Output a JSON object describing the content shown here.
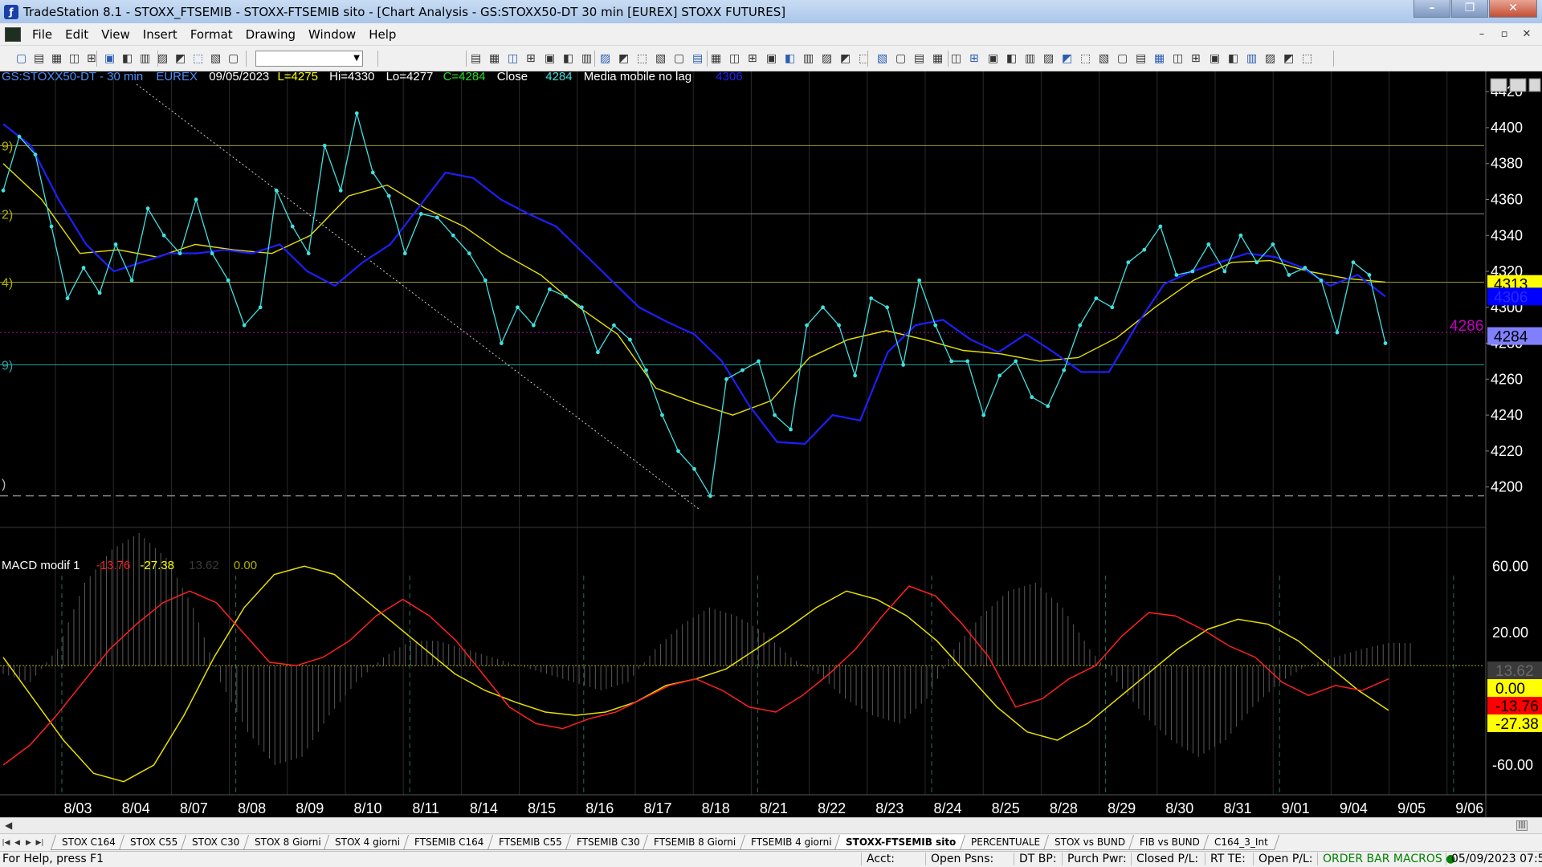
{
  "window": {
    "title": "TradeStation 8.1 - STOXX_FTSEMIB - STOXX-FTSEMIB sito - [Chart Analysis - GS:STOXX50-DT  30 min  [EUREX] STOXX FUTURES]"
  },
  "menu": [
    "File",
    "Edit",
    "View",
    "Insert",
    "Format",
    "Drawing",
    "Window",
    "Help"
  ],
  "price_header": {
    "symbol": "GS:STOXX50-DT - 30 min",
    "exchange": "EUREX",
    "date": "09/05/2023",
    "l": "L=4275",
    "hi": "Hi=4330",
    "lo": "Lo=4277",
    "c": "C=4284",
    "close_label": "Close",
    "close_value": "4284",
    "ma_label": "Media mobile no lag",
    "ma_value": "4306"
  },
  "macd_header": {
    "name": "MACD modif 1",
    "v1": "-13.76",
    "v2": "-27.38",
    "v3": "13.62",
    "v4": "0.00"
  },
  "left_labels": [
    "9)",
    "2)",
    "4)",
    "9)",
    ")"
  ],
  "price_axis": [
    "4420",
    "4400",
    "4380",
    "4360",
    "4340",
    "4320",
    "4300",
    "4280",
    "4260",
    "4240",
    "4220",
    "4200"
  ],
  "price_badges": [
    {
      "text": "4313",
      "price": 4313,
      "bg": "#ffff00",
      "fg": "#000000"
    },
    {
      "text": "4306",
      "price": 4306,
      "bg": "#0000ff",
      "fg": "#2a2aff"
    },
    {
      "text": "4284",
      "price": 4284,
      "bg": "#8080ff",
      "fg": "#000000"
    }
  ],
  "price_side_label": {
    "text": "4286",
    "price": 4286,
    "color": "#c000c0"
  },
  "macd_axis": [
    "60.00",
    "20.00",
    "-60.00"
  ],
  "macd_badges": [
    {
      "text": "13.62",
      "bg": "#3a3a3a",
      "fg": "#6a6a6a"
    },
    {
      "text": "0.00",
      "bg": "#ffff00",
      "fg": "#000000"
    },
    {
      "text": "-13.76",
      "bg": "#ff0000",
      "fg": "#000000"
    },
    {
      "text": "-27.38",
      "bg": "#ffff00",
      "fg": "#000000"
    }
  ],
  "time_axis": [
    "8/03",
    "8/04",
    "8/07",
    "8/08",
    "8/09",
    "8/10",
    "8/11",
    "8/14",
    "8/15",
    "8/16",
    "8/17",
    "8/18",
    "8/21",
    "8/22",
    "8/23",
    "8/24",
    "8/25",
    "8/28",
    "8/29",
    "8/30",
    "8/31",
    "9/01",
    "9/04",
    "9/05",
    "9/06"
  ],
  "hlines": [
    {
      "price": 4390,
      "color": "#9a9a2a",
      "style": "solid"
    },
    {
      "price": 4352,
      "color": "#8a8a8a",
      "style": "solid"
    },
    {
      "price": 4314,
      "color": "#9a9a2a",
      "style": "solid"
    },
    {
      "price": 4286,
      "color": "#c000c0",
      "style": "dotted"
    },
    {
      "price": 4268,
      "color": "#2aa0a0",
      "style": "solid"
    },
    {
      "price": 4195,
      "color": "#bbbbbb",
      "style": "dashed"
    }
  ],
  "colors": {
    "background": "#000000",
    "price": "#40e0e0",
    "ma_blue": "#1e1eff",
    "ma_yellow": "#e8e000",
    "macd_red": "#ff2020",
    "macd_yellow": "#e8e000",
    "histogram": "#5a5a5a",
    "grid": "#2a2a2a",
    "session": "#1f6f5f",
    "trendline": "#cccccc"
  },
  "chart_data": {
    "type": "line",
    "title": "GS:STOXX50-DT - 30 min",
    "xlabel": "",
    "ylabel": "",
    "ylim": [
      4190,
      4425
    ],
    "series": [
      {
        "name": "Close",
        "values": [
          4365,
          4395,
          4385,
          4345,
          4305,
          4322,
          4308,
          4335,
          4315,
          4355,
          4340,
          4330,
          4360,
          4330,
          4315,
          4290,
          4300,
          4365,
          4345,
          4330,
          4390,
          4365,
          4408,
          4375,
          4362,
          4330,
          4352,
          4350,
          4340,
          4330,
          4315,
          4280,
          4300,
          4290,
          4310,
          4306,
          4300,
          4275,
          4290,
          4282,
          4265,
          4240,
          4220,
          4210,
          4195,
          4260,
          4265,
          4270,
          4240,
          4232,
          4290,
          4300,
          4290,
          4262,
          4305,
          4300,
          4268,
          4315,
          4290,
          4270,
          4270,
          4240,
          4262,
          4270,
          4250,
          4245,
          4265,
          4290,
          4305,
          4300,
          4325,
          4332,
          4345,
          4318,
          4320,
          4335,
          4320,
          4340,
          4325,
          4335,
          4318,
          4322,
          4315,
          4286,
          4325,
          4318,
          4280
        ]
      },
      {
        "name": "Media mobile no lag",
        "values": [
          4402,
          4390,
          4360,
          4335,
          4320,
          4325,
          4330,
          4330,
          4332,
          4330,
          4335,
          4320,
          4312,
          4325,
          4335,
          4355,
          4375,
          4372,
          4360,
          4352,
          4345,
          4330,
          4315,
          4300,
          4292,
          4285,
          4270,
          4245,
          4225,
          4224,
          4240,
          4237,
          4275,
          4290,
          4293,
          4282,
          4275,
          4285,
          4275,
          4264,
          4264,
          4290,
          4313,
          4320,
          4325,
          4330,
          4328,
          4322,
          4312,
          4318,
          4306
        ]
      },
      {
        "name": "Media mobile",
        "values": [
          4380,
          4360,
          4330,
          4332,
          4328,
          4335,
          4332,
          4330,
          4340,
          4362,
          4368,
          4355,
          4345,
          4330,
          4318,
          4300,
          4285,
          4255,
          4247,
          4240,
          4248,
          4272,
          4282,
          4287,
          4282,
          4276,
          4274,
          4270,
          4272,
          4283,
          4300,
          4315,
          4325,
          4326,
          4320,
          4316,
          4314
        ]
      }
    ],
    "macd": {
      "name": "MACD modif 1",
      "ylim": [
        -75,
        80
      ],
      "red": [
        -60,
        -48,
        -30,
        -10,
        10,
        25,
        38,
        45,
        38,
        20,
        2,
        0,
        5,
        15,
        30,
        40,
        30,
        15,
        -5,
        -25,
        -35,
        -38,
        -32,
        -28,
        -20,
        -12,
        -8,
        -15,
        -25,
        -28,
        -18,
        -5,
        10,
        30,
        48,
        42,
        25,
        5,
        -25,
        -20,
        -8,
        0,
        18,
        32,
        30,
        22,
        12,
        5,
        -10,
        -18,
        -12,
        -15,
        -8
      ],
      "yellow": [
        5,
        -20,
        -45,
        -65,
        -70,
        -60,
        -30,
        5,
        35,
        55,
        60,
        55,
        40,
        25,
        10,
        -5,
        -15,
        -22,
        -28,
        -30,
        -28,
        -22,
        -12,
        -8,
        -2,
        10,
        22,
        35,
        45,
        40,
        30,
        15,
        -5,
        -25,
        -40,
        -45,
        -35,
        -20,
        -5,
        10,
        22,
        28,
        25,
        15,
        0,
        -15,
        -27
      ],
      "histogram": [
        -5,
        -10,
        10,
        50,
        70,
        80,
        65,
        35,
        -10,
        -40,
        -60,
        -55,
        -30,
        -10,
        5,
        15,
        15,
        10,
        5,
        0,
        -5,
        -10,
        -15,
        -10,
        10,
        25,
        35,
        30,
        20,
        5,
        -5,
        -20,
        -30,
        -35,
        -20,
        10,
        30,
        45,
        50,
        35,
        10,
        -10,
        -30,
        -45,
        -55,
        -45,
        -25,
        -10,
        0,
        5,
        10,
        13.62
      ]
    }
  }
}
